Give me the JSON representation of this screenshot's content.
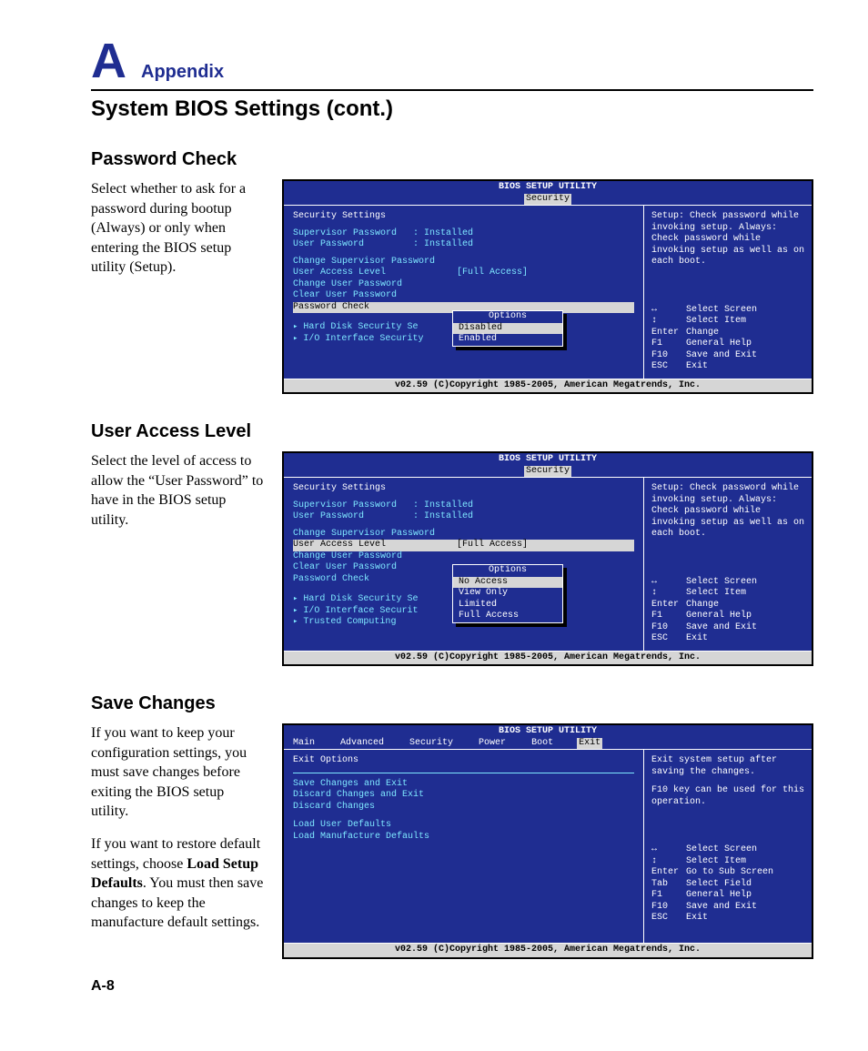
{
  "header": {
    "letter": "A",
    "label": "Appendix"
  },
  "page_title": "System BIOS Settings (cont.)",
  "page_number": "A-8",
  "sections": {
    "password_check": {
      "title": "Password Check",
      "desc": "Select whether to ask for a password during bootup (Always) or only when entering the BIOS setup utility (Setup)."
    },
    "user_access_level": {
      "title": "User Access Level",
      "desc": "Select the level of access to allow the “User Pass­word” to have in the BIOS setup utility."
    },
    "save_changes": {
      "title": "Save Changes",
      "desc1": "If you want to keep your configuration settings, you must save changes before exiting the BIOS setup utility.",
      "desc2a": "If you want to restore default settings, choose ",
      "desc2bold": "Load Setup Defaults",
      "desc2b": ". You must then save changes to keep the manufacture default settings."
    }
  },
  "bios": {
    "title": "BIOS SETUP UTILITY",
    "footer": "v02.59 (C)Copyright 1985-2005, American Megatrends, Inc.",
    "tabs_full": [
      "Main",
      "Advanced",
      "Security",
      "Power",
      "Boot",
      "Exit"
    ],
    "security_tab": "Security",
    "sec_settings_header": "Security Settings",
    "supervisor_pw_label": "Supervisor Password",
    "user_pw_label": "User Password",
    "installed": ": Installed",
    "change_supervisor": "Change Supervisor Password",
    "user_access_level": "User Access Level",
    "full_access_val": "[Full Access]",
    "change_user_pw": "Change User Password",
    "clear_user_pw": "Clear User Password",
    "password_check": "Password Check",
    "hdd_sec": "Hard Disk Security Se",
    "hdd_sec2": "Hard Disk Security Se",
    "io_sec": "I/O Interface Security",
    "io_sec2": "I/O Interface Securit",
    "trusted": "Trusted Computing",
    "exit_options_header": "Exit Options",
    "save_exit": "Save Changes and Exit",
    "discard_exit": "Discard Changes and Exit",
    "discard": "Discard Changes",
    "load_user": "Load User Defaults",
    "load_manuf": "Load Manufacture Defaults",
    "help_setup": "Setup: Check password while invoking setup. Always: Check password while invoking setup as well as on each boot.",
    "help_exit1": "Exit system setup after saving the changes.",
    "help_exit2": "F10 key can be used for this operation.",
    "nav": {
      "select_screen": "Select Screen",
      "select_item": "Select Item",
      "enter_change": "Change",
      "enter_sub": "Go to Sub Screen",
      "tab_field": "Select Field",
      "f1": "General Help",
      "f10": "Save and Exit",
      "esc": "Exit",
      "enter_key": "Enter",
      "tab_key": "Tab",
      "f1_key": "F1",
      "f10_key": "F10",
      "esc_key": "ESC"
    },
    "popup1": {
      "title": "Options",
      "items": [
        "Disabled",
        "Enabled"
      ]
    },
    "popup2": {
      "title": "Options",
      "items": [
        "No Access",
        "View Only",
        "Limited",
        "Full Access"
      ]
    }
  }
}
